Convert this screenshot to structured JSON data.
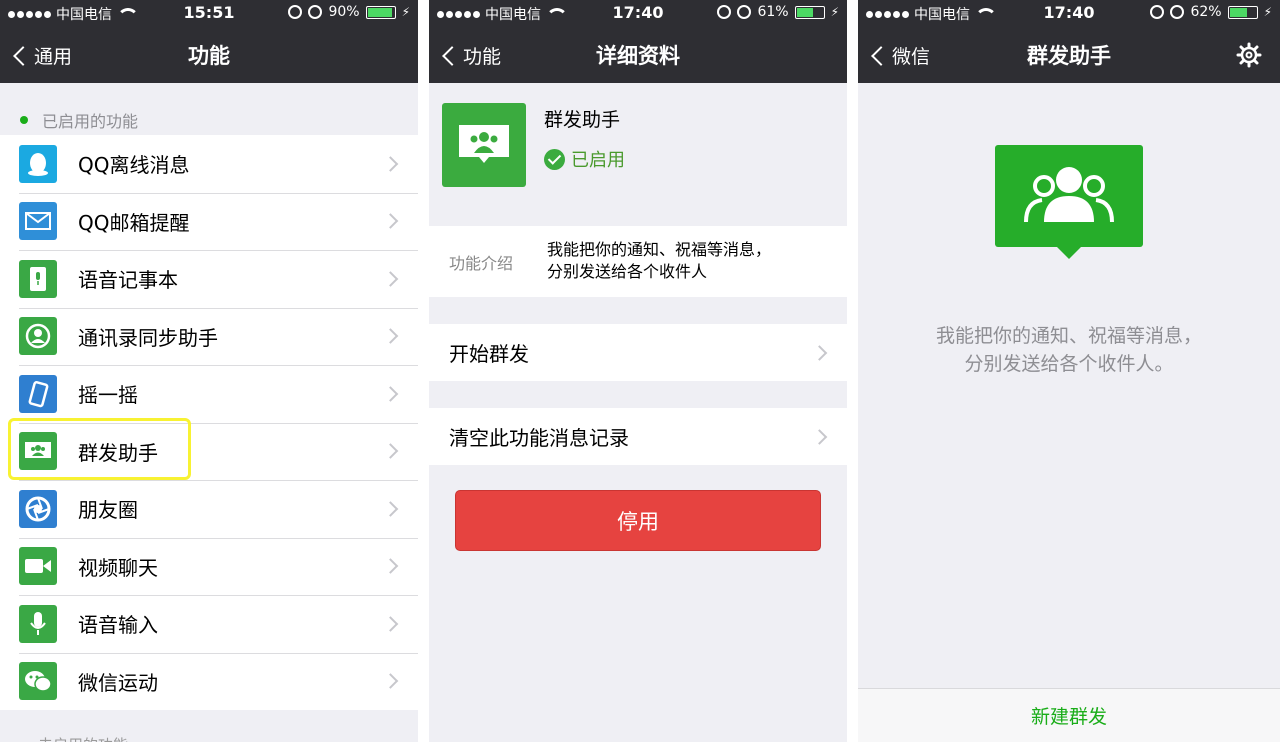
{
  "status_bars": [
    {
      "carrier": "中国电信",
      "time": "15:51",
      "battery": "90%",
      "battery_level": 0.9
    },
    {
      "carrier": "中国电信",
      "time": "17:40",
      "battery": "61%",
      "battery_level": 0.61
    },
    {
      "carrier": "中国电信",
      "time": "17:40",
      "battery": "62%",
      "battery_level": 0.62
    }
  ],
  "screen1": {
    "back_label": "通用",
    "title": "功能",
    "section_enabled": "已启用的功能",
    "items": [
      {
        "label": "QQ离线消息",
        "icon": "qq-penguin-icon",
        "color": "#1ba9e1"
      },
      {
        "label": "QQ邮箱提醒",
        "icon": "mail-icon",
        "color": "#2f8fd8"
      },
      {
        "label": "语音记事本",
        "icon": "voice-note-icon",
        "color": "#3aa845"
      },
      {
        "label": "通讯录同步助手",
        "icon": "contact-sync-icon",
        "color": "#3aa845"
      },
      {
        "label": "摇一摇",
        "icon": "shake-icon",
        "color": "#2f7fd0"
      },
      {
        "label": "群发助手",
        "icon": "broadcast-icon",
        "color": "#3aa845"
      },
      {
        "label": "朋友圈",
        "icon": "moments-icon",
        "color": "#2f7fd0"
      },
      {
        "label": "视频聊天",
        "icon": "video-icon",
        "color": "#3aa845"
      },
      {
        "label": "语音输入",
        "icon": "mic-icon",
        "color": "#3aa845"
      },
      {
        "label": "微信运动",
        "icon": "wechat-sport-icon",
        "color": "#3aa845"
      }
    ],
    "section_disabled": "未启用的功能"
  },
  "screen2": {
    "back_label": "功能",
    "title": "详细资料",
    "name": "群发助手",
    "status": "已启用",
    "intro_label": "功能介绍",
    "intro_line1": "我能把你的通知、祝福等消息，",
    "intro_line2": "分别发送给各个收件人",
    "action_start": "开始群发",
    "action_clear": "清空此功能消息记录",
    "disable_button": "停用"
  },
  "screen3": {
    "back_label": "微信",
    "title": "群发助手",
    "desc_line1": "我能把你的通知、祝福等消息，",
    "desc_line2": "分别发送给各个收件人。",
    "new_button": "新建群发"
  },
  "colors": {
    "navbar": "#2e2e33",
    "green": "#1aad19",
    "red": "#e64340",
    "highlight": "#f8f232"
  }
}
